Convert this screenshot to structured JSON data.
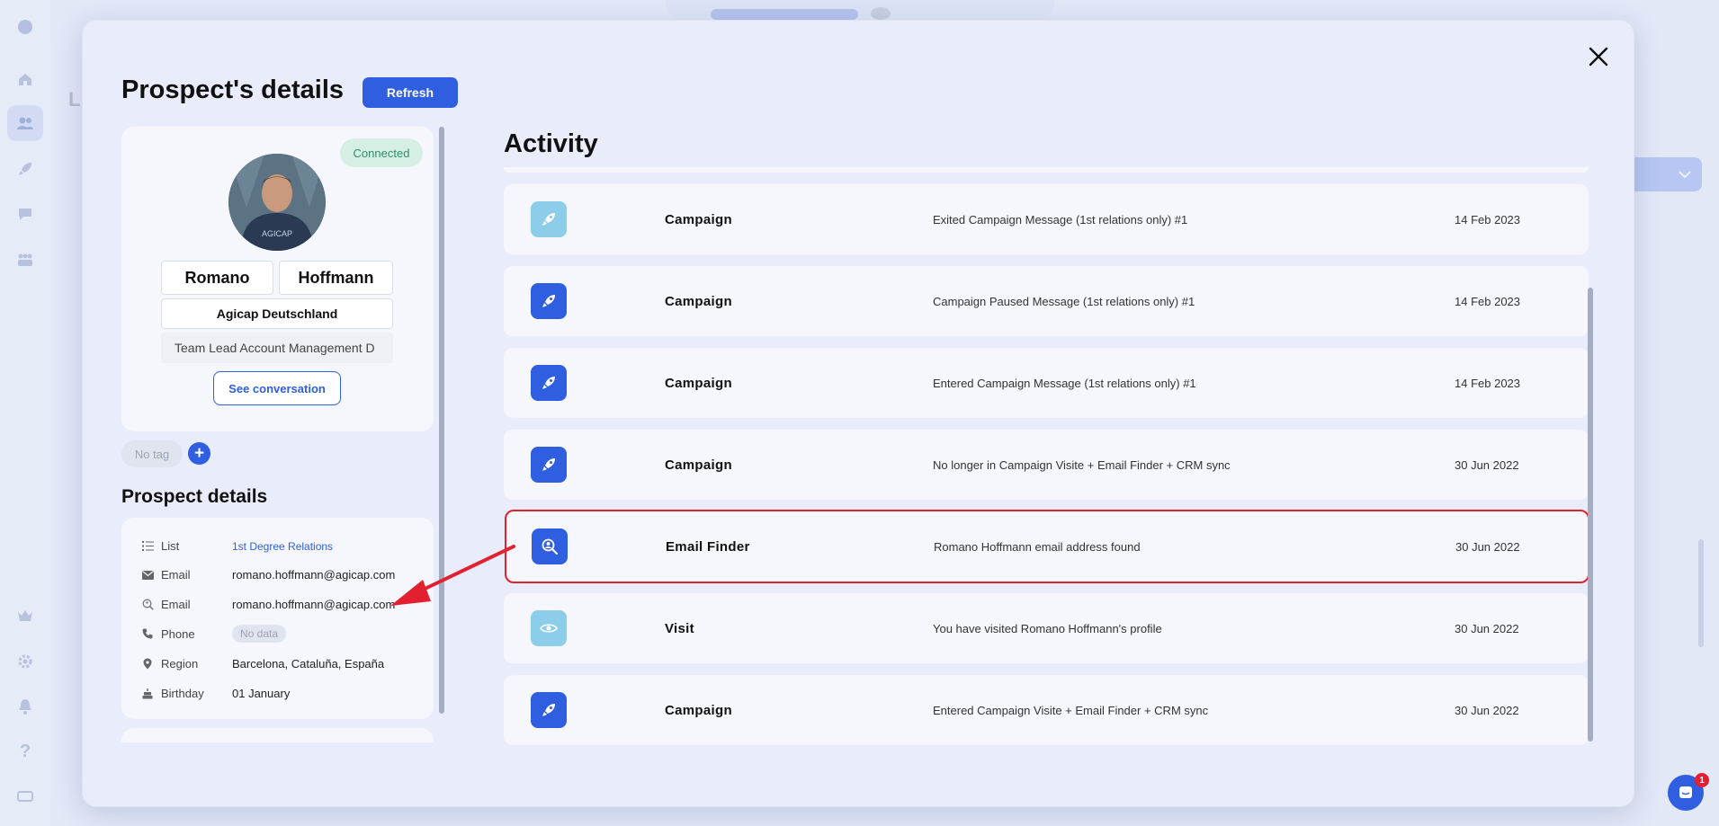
{
  "modal": {
    "title": "Prospect's details",
    "refresh_label": "Refresh"
  },
  "profile": {
    "status_badge": "Connected",
    "first_name": "Romano",
    "last_name": "Hoffmann",
    "company": "Agicap Deutschland",
    "job_title": "Team Lead Account Management D",
    "see_conversation_label": "See conversation",
    "no_tag_label": "No tag",
    "add_tag_label": "+"
  },
  "details": {
    "heading": "Prospect details",
    "rows": [
      {
        "icon": "list-icon",
        "label": "List",
        "value": "1st Degree Relations"
      },
      {
        "icon": "envelope-icon",
        "label": "Email",
        "value": "romano.hoffmann@agicap.com"
      },
      {
        "icon": "email-finder-icon",
        "label": "Email",
        "value": "romano.hoffmann@agicap.com"
      },
      {
        "icon": "phone-icon",
        "label": "Phone",
        "value": "No data"
      },
      {
        "icon": "location-pin-icon",
        "label": "Region",
        "value": "Barcelona, Cataluña, España"
      },
      {
        "icon": "cake-icon",
        "label": "Birthday",
        "value": "01 January"
      }
    ]
  },
  "activity": {
    "heading": "Activity",
    "items": [
      {
        "icon": "rocket-icon",
        "icon_style": "light",
        "type": "Campaign",
        "description": "Exited Campaign Message (1st relations only) #1",
        "date": "14 Feb 2023"
      },
      {
        "icon": "rocket-icon",
        "icon_style": "dark",
        "type": "Campaign",
        "description": "Campaign Paused Message (1st relations only) #1",
        "date": "14 Feb 2023"
      },
      {
        "icon": "rocket-icon",
        "icon_style": "dark",
        "type": "Campaign",
        "description": "Entered Campaign Message (1st relations only) #1",
        "date": "14 Feb 2023"
      },
      {
        "icon": "rocket-icon",
        "icon_style": "dark",
        "type": "Campaign",
        "description": "No longer in Campaign Visite + Email Finder + CRM sync",
        "date": "30 Jun 2022"
      },
      {
        "icon": "email-finder-icon",
        "icon_style": "dark",
        "type": "Email Finder",
        "description": "Romano Hoffmann email address found",
        "date": "30 Jun 2022"
      },
      {
        "icon": "eye-icon",
        "icon_style": "light",
        "type": "Visit",
        "description": "You have visited Romano Hoffmann's profile",
        "date": "30 Jun 2022"
      },
      {
        "icon": "rocket-icon",
        "icon_style": "dark",
        "type": "Campaign",
        "description": "Entered Campaign Visite + Email Finder + CRM sync",
        "date": "30 Jun 2022"
      }
    ]
  },
  "chat": {
    "badge_count": "1"
  },
  "colors": {
    "accent": "#2f5ee0",
    "icon_dark": "#2f5ee0",
    "icon_light": "#8ccdea",
    "highlight": "#e3202f",
    "connected_bg": "#d6efe4",
    "connected_text": "#2f8f66"
  }
}
